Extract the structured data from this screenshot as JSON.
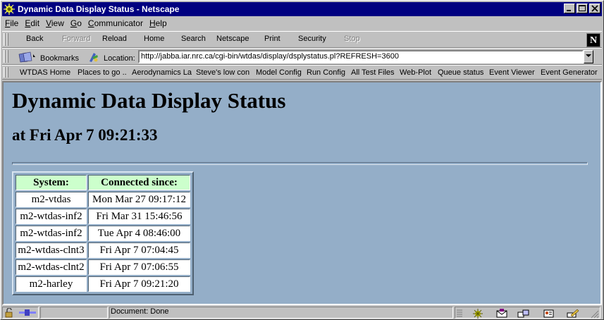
{
  "window": {
    "title": "Dynamic Data Display Status - Netscape"
  },
  "menu": [
    "File",
    "Edit",
    "View",
    "Go",
    "Communicator",
    "Help"
  ],
  "menu_underline": [
    "F",
    "E",
    "V",
    "G",
    "C",
    "H"
  ],
  "nav": {
    "back": "Back",
    "forward": "Forward",
    "reload": "Reload",
    "home": "Home",
    "search": "Search",
    "netscape": "Netscape",
    "print": "Print",
    "security": "Security",
    "stop": "Stop"
  },
  "location": {
    "bookmarks_label": "Bookmarks",
    "location_label": "Location:",
    "url": "http://jabba.iar.nrc.ca/cgi-bin/wtdas/display/dsplystatus.pl?REFRESH=3600"
  },
  "personal": [
    "WTDAS Home",
    "Places to go ..",
    "Aerodynamics La",
    "Steve's low con",
    "Model Config",
    "Run Config",
    "All Test Files",
    "Web-Plot",
    "Queue status",
    "Event Viewer",
    "Event Generator"
  ],
  "page": {
    "heading": "Dynamic Data Display Status",
    "subheading": "at Fri Apr 7 09:21:33",
    "table": {
      "headers": [
        "System:",
        "Connected since:"
      ],
      "rows": [
        [
          "m2-vtdas",
          "Mon Mar 27 09:17:12"
        ],
        [
          "m2-wtdas-inf2",
          "Fri Mar 31 15:46:56"
        ],
        [
          "m2-wtdas-inf2",
          "Tue Apr 4 08:46:00"
        ],
        [
          "m2-wtdas-clnt3",
          "Fri Apr 7 07:04:45"
        ],
        [
          "m2-wtdas-clnt2",
          "Fri Apr 7 07:06:55"
        ],
        [
          "m2-harley",
          "Fri Apr 7 09:21:20"
        ]
      ]
    }
  },
  "status": {
    "text": "Document: Done"
  },
  "colors": {
    "page_bg": "#94aec8",
    "header_cell": "#ccffcc",
    "titlebar": "#000080"
  }
}
